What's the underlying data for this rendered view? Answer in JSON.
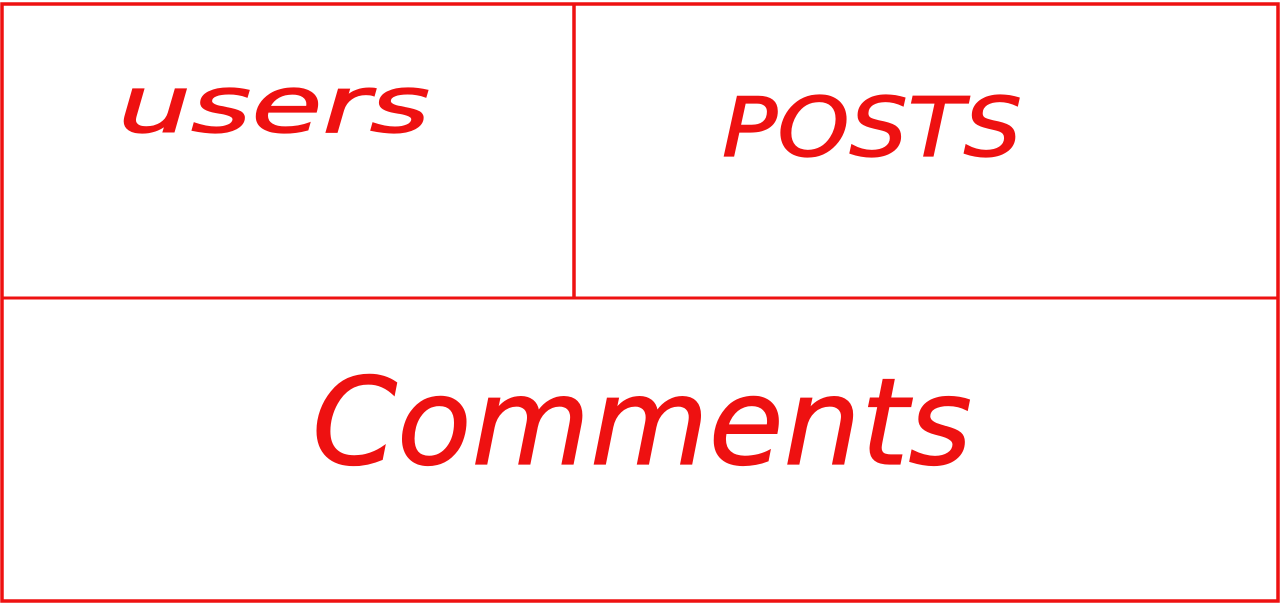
{
  "colors": {
    "stroke": "#ee1111",
    "background": "#ffffff"
  },
  "panels": {
    "users": {
      "label": "users"
    },
    "posts": {
      "label": "POSTS"
    },
    "comments": {
      "label": "Comments"
    }
  }
}
